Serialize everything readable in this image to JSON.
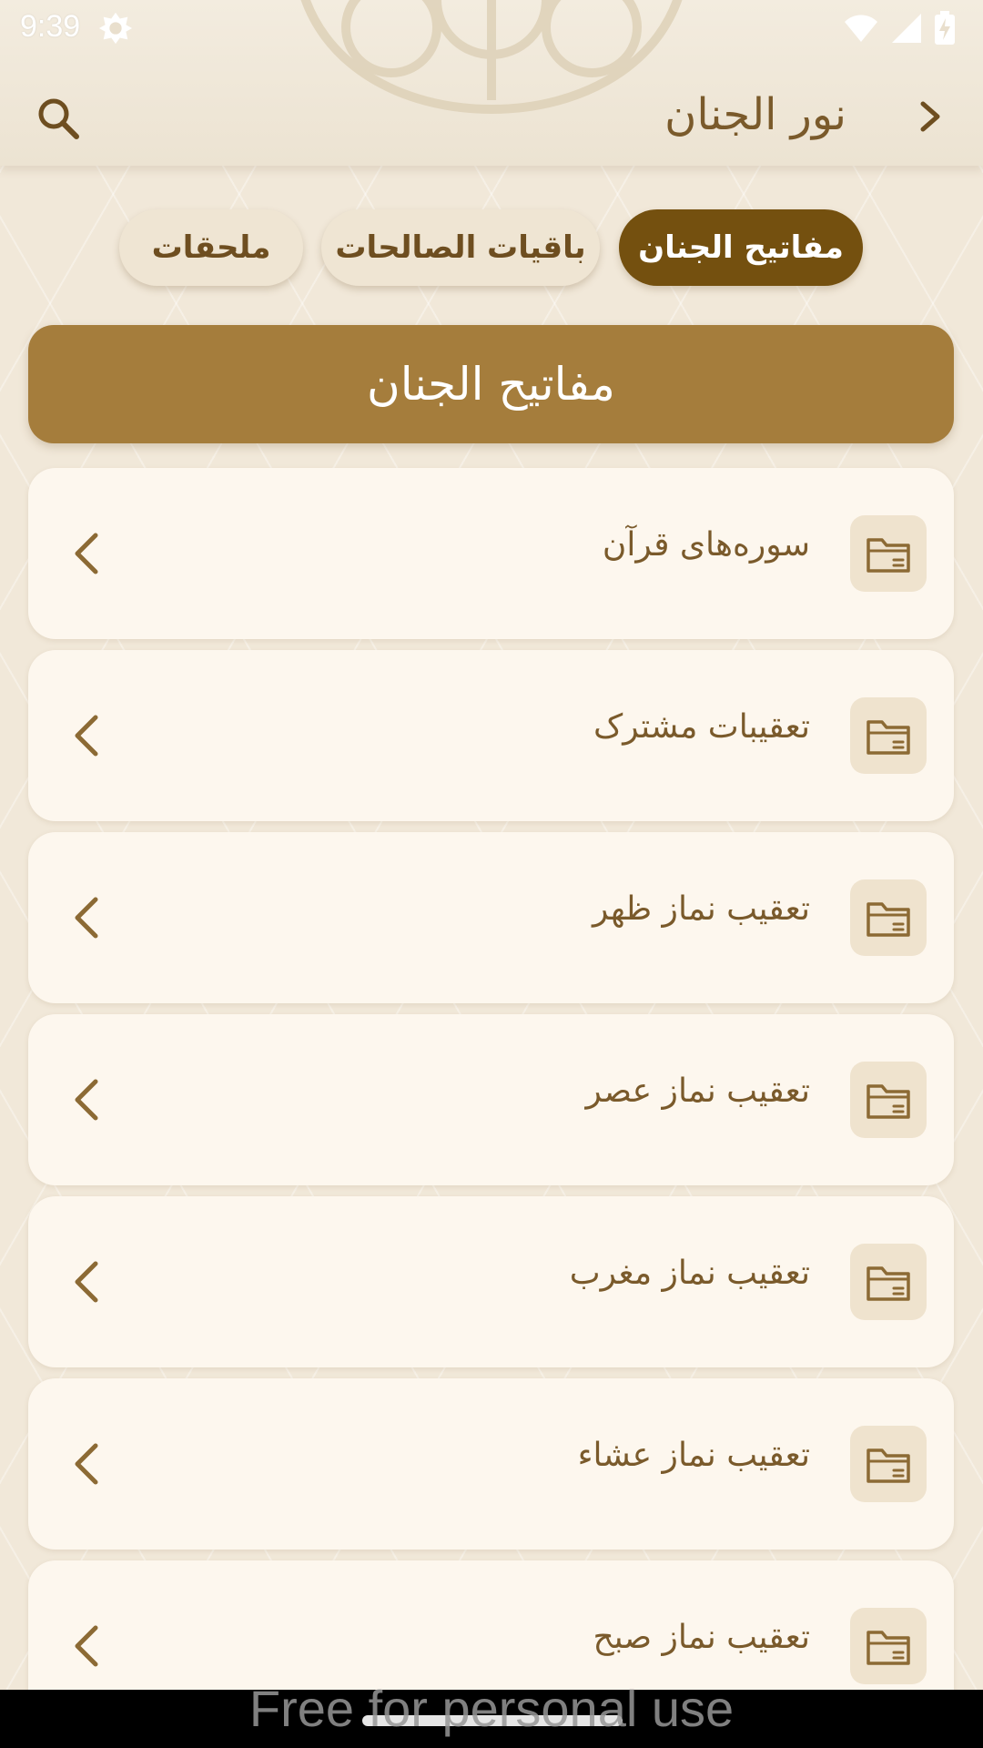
{
  "status_bar": {
    "time": "9:39"
  },
  "app_bar": {
    "title": "نور الجنان",
    "back_icon": "chevron-right-icon",
    "search_icon": "search-icon"
  },
  "tabs": [
    {
      "label": "مفاتیح الجنان",
      "active": true
    },
    {
      "label": "باقیات الصالحات",
      "active": false
    },
    {
      "label": "ملحقات",
      "active": false
    }
  ],
  "section": {
    "title": "مفاتیح الجنان"
  },
  "list": {
    "item_icon": "folder-icon",
    "chevron_icon": "chevron-left-icon",
    "items": [
      {
        "label": "سوره‌های قرآن"
      },
      {
        "label": "تعقیبات مشترک"
      },
      {
        "label": "تعقیب نماز ظهر"
      },
      {
        "label": "تعقیب نماز عصر"
      },
      {
        "label": "تعقیب نماز مغرب"
      },
      {
        "label": "تعقیب نماز عشاء"
      },
      {
        "label": "تعقیب نماز صبح"
      }
    ]
  },
  "watermark": "Free for personal use",
  "colors": {
    "accent_dark": "#74500f",
    "accent": "#a57d3c",
    "text_brown": "#7a5a2b",
    "card_bg": "#fdf7ee"
  }
}
